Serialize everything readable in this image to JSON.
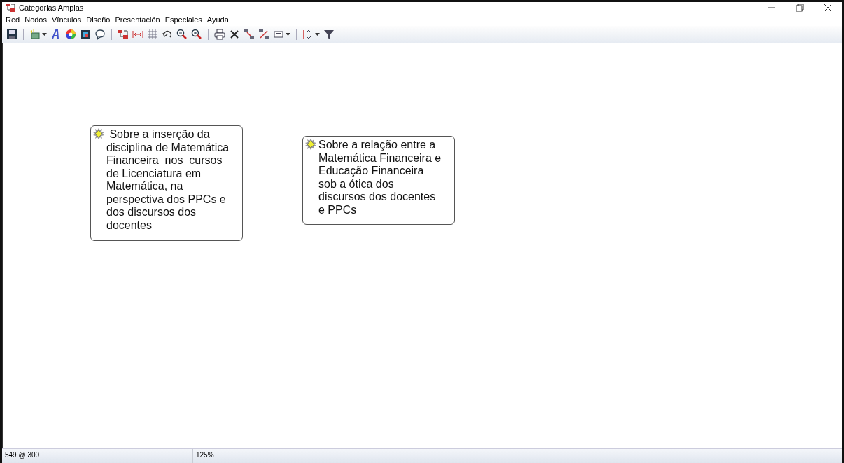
{
  "window": {
    "title": "Categorias Amplas"
  },
  "menu": [
    "Red",
    "Nodos",
    "Vínculos",
    "Diseño",
    "Presentación",
    "Especiales",
    "Ayuda"
  ],
  "nodes": [
    {
      "text": " Sobre a inserção da\ndisciplina de Matemática\nFinanceira  nos  cursos\nde Licenciatura em\nMatemática, na\nperspectiva dos PPCs e\ndos discursos dos\ndocentes"
    },
    {
      "text": "Sobre a relação entre a\nMatemática Financeira e\nEducação Financeira\nsob a ótica dos\ndiscursos dos docentes\ne PPCs"
    }
  ],
  "status_bar": {
    "position": "549 @ 300",
    "zoom": "125%"
  }
}
